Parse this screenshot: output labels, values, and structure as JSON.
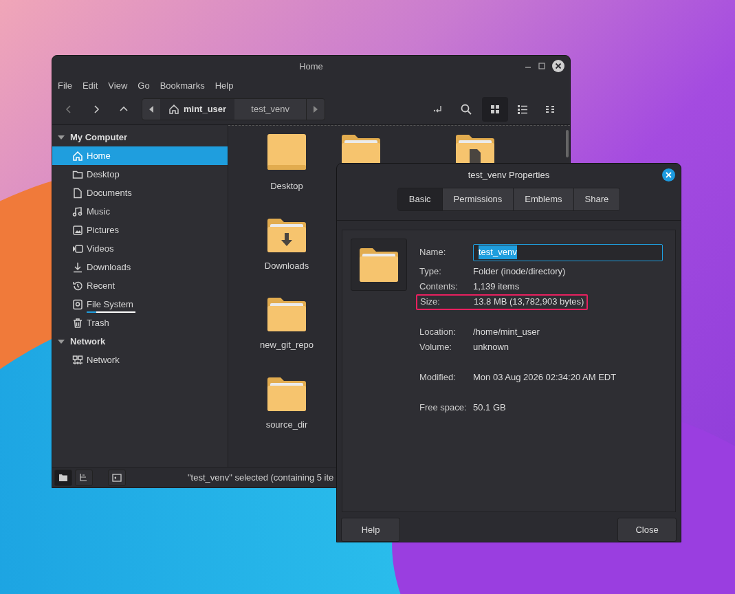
{
  "file_manager": {
    "title": "Home",
    "menu": [
      "File",
      "Edit",
      "View",
      "Go",
      "Bookmarks",
      "Help"
    ],
    "path": [
      {
        "label": "mint_user",
        "kind": "home",
        "selected": true
      },
      {
        "label": "test_venv",
        "kind": "folder",
        "selected": false
      }
    ],
    "view_modes": [
      {
        "kind": "icons",
        "selected": true
      },
      {
        "kind": "list",
        "selected": false
      },
      {
        "kind": "compact",
        "selected": false
      }
    ],
    "sidebar": [
      {
        "label": "My Computer",
        "expanded": true,
        "children": [
          {
            "label": "Home",
            "kind": "home",
            "selected": true
          },
          {
            "label": "Desktop",
            "kind": "folder",
            "selected": false
          },
          {
            "label": "Documents",
            "kind": "document",
            "selected": false
          },
          {
            "label": "Music",
            "kind": "music",
            "selected": false
          },
          {
            "label": "Pictures",
            "kind": "picture",
            "selected": false
          },
          {
            "label": "Videos",
            "kind": "video",
            "selected": false
          },
          {
            "label": "Downloads",
            "kind": "download",
            "selected": false
          },
          {
            "label": "Recent",
            "kind": "recent",
            "selected": false
          },
          {
            "label": "File System",
            "kind": "drive",
            "selected": false,
            "level": 0.2
          },
          {
            "label": "Trash",
            "kind": "trash",
            "selected": false
          }
        ]
      },
      {
        "label": "Network",
        "expanded": true,
        "children": [
          {
            "label": "Network",
            "kind": "network",
            "selected": false
          }
        ]
      }
    ],
    "partial_icons": [
      {
        "kind": "folder"
      },
      {
        "kind": "document-folder"
      }
    ],
    "files": [
      {
        "label": "Desktop",
        "kind": "desktop"
      },
      {
        "label": "Downloads",
        "kind": "download"
      },
      {
        "label": "new_git_repo",
        "kind": "folder"
      },
      {
        "label": "source_dir",
        "kind": "folder"
      }
    ],
    "status_bar": {
      "text": "\"test_venv\" selected (containing 5 ite",
      "buttons": [
        {
          "kind": "places",
          "selected": true
        },
        {
          "kind": "tree",
          "selected": false
        },
        {
          "kind": "sidebar-toggle",
          "selected": false
        }
      ]
    }
  },
  "properties_dialog": {
    "title": "test_venv Properties",
    "tabs": [
      {
        "label": "Basic",
        "selected": true
      },
      {
        "label": "Permissions",
        "selected": false
      },
      {
        "label": "Emblems",
        "selected": false
      },
      {
        "label": "Share",
        "selected": false
      }
    ],
    "name_label": "Name:",
    "name_value": "test_venv",
    "groups": [
      [
        {
          "label": "Type:",
          "value": "Folder (inode/directory)",
          "highlighted": false
        },
        {
          "label": "Contents:",
          "value": "1,139 items",
          "highlighted": false
        },
        {
          "label": "Size:",
          "value": "13.8 MB (13,782,903 bytes)",
          "highlighted": true
        }
      ],
      [
        {
          "label": "Location:",
          "value": "/home/mint_user",
          "highlighted": false
        },
        {
          "label": "Volume:",
          "value": "unknown",
          "highlighted": false
        }
      ],
      [
        {
          "label": "Modified:",
          "value": "Mon 03 Aug 2026 02:34:20 AM EDT",
          "highlighted": false
        }
      ],
      [
        {
          "label": "Free space:",
          "value": "50.1 GB",
          "highlighted": false
        }
      ]
    ],
    "buttons": [
      "Help",
      "Close"
    ]
  }
}
